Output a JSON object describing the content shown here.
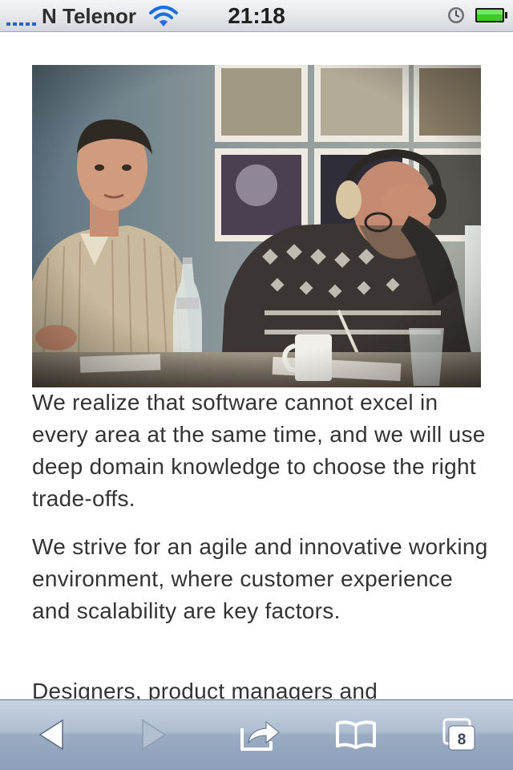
{
  "status_bar": {
    "carrier": "N Telenor",
    "time": "21:18",
    "signal_bars": 5,
    "battery_level": 1.0,
    "battery_color": "#3ecb26",
    "wifi_color": "#1d6fe0"
  },
  "main": {
    "photo": {
      "icon": "photo-two-men-at-meeting-table"
    },
    "paragraphs": [
      "We realize that software cannot excel in every area at the same time, and we will use deep domain knowledge to choose the right trade-offs.",
      "We strive for an agile and innovative working environment, where customer experience and scalability are key factors.",
      "Designers, product managers and"
    ]
  },
  "toolbar": {
    "back_icon": "back-arrow-icon",
    "forward_icon": "forward-arrow-icon",
    "share_icon": "share-icon",
    "bookmarks_icon": "bookmarks-icon",
    "tabs_icon": "tabs-icon",
    "tab_count": "8",
    "forward_enabled": false
  }
}
